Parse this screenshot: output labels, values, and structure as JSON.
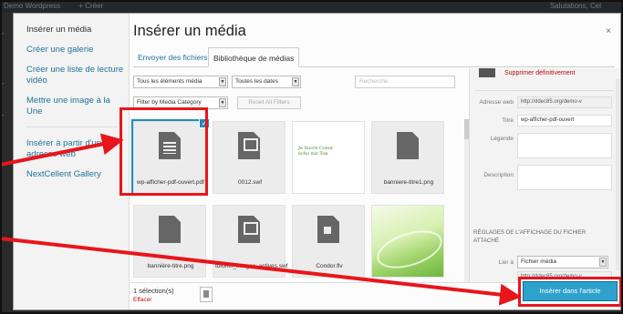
{
  "adminbar": {
    "items": [
      "Demo Wordpress",
      "+ Créer"
    ],
    "right": "Salutations, Cel"
  },
  "sidebar": {
    "items": [
      {
        "label": "Insérer un média",
        "active": true
      },
      {
        "label": "Créer une galerie"
      },
      {
        "label": "Créer une liste de lecture vidéo"
      },
      {
        "label": "Mettre une image à la Une"
      },
      {
        "label": "Insérer à partir d'une adresse web"
      },
      {
        "label": "NextCellent Gallery"
      }
    ]
  },
  "modal": {
    "title": "Insérer un média",
    "close": "×"
  },
  "tabs": {
    "upload": "Envoyer des fichiers",
    "library": "Bibliothèque de médias"
  },
  "filters": {
    "type": "Tous les éléments média",
    "dates": "Toutes les dates",
    "category": "Filter by Media Category",
    "reset": "Reset All Filters",
    "search_placeholder": "Recherche"
  },
  "media": [
    {
      "name": "wp-afficher-pdf-ouvert.pdf",
      "kind": "document",
      "selected": true
    },
    {
      "name": "0012.swf",
      "kind": "flash"
    },
    {
      "name": "",
      "kind": "image-text",
      "image_text": "Je Sucré Coeur\nécho sur Ton"
    },
    {
      "name": "banniere-titre1.png",
      "kind": "document"
    },
    {
      "name": "bannière-titre.png",
      "kind": "document"
    },
    {
      "name": "tutoriel_images_actives.swf",
      "kind": "flash"
    },
    {
      "name": "Condor.flv",
      "kind": "video"
    },
    {
      "name": "",
      "kind": "image-swirl"
    }
  ],
  "details": {
    "delete": "Supprimer définitivement",
    "url_label": "Adresse web",
    "url_value": "http://ddec85.org/demo-v",
    "title_label": "Titre",
    "title_value": "wp-afficher-pdf-ouvert",
    "caption_label": "Légende",
    "description_label": "Description",
    "settings_heading": "RÉGLAGES DE L'AFFICHAGE DU FICHIER ATTACHÉ",
    "link_label": "Lier à",
    "link_value": "Fichier média",
    "link_url": "http://ddec85.org/demo-v"
  },
  "footer": {
    "count": "1 sélection(s)",
    "clear": "Effacer",
    "insert": "Insérer dans l'article"
  },
  "colors": {
    "accent": "#2ea2cc",
    "annotation": "#e8151b",
    "link": "#21759b"
  }
}
